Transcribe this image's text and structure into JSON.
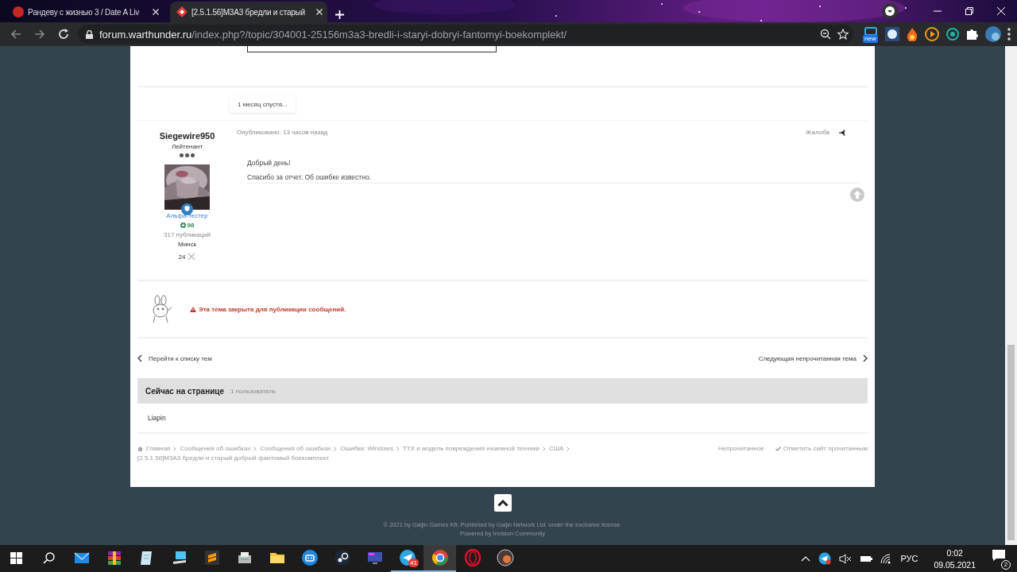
{
  "browser": {
    "tabs": [
      {
        "title": "Рандеву с жизнью 3 / Date A Liv",
        "selected": false
      },
      {
        "title": "[2.5.1.56]M3A3 бредли и старый",
        "selected": true
      }
    ],
    "address": {
      "host": "forum.warthunder.ru",
      "path": "/index.php?/topic/304001-25156m3a3-bredli-i-staryi-dobryi-fantomyi-boekomplekt/"
    },
    "extension_badge": "new"
  },
  "forum": {
    "time_gap": "1 месяц спустя...",
    "post": {
      "author": "Siegewire950",
      "rank": "Лейтенант",
      "group": "Альфа-тестер",
      "reputation": "98",
      "posts": "317 публикаций",
      "location": "Минск",
      "medals": "24",
      "posted": "Опубликовано: 13 часов назад",
      "report": "Жалоба",
      "body": [
        "Добрый день!",
        "Спасибо за отчет. Об ошибке известно."
      ]
    },
    "locked_notice": "Эта тема закрыта для публикации сообщений.",
    "prev_link": "Перейти к списку тем",
    "next_link": "Следующая непрочитанная тема",
    "online": {
      "title": "Сейчас на странице",
      "count": "1 пользователь",
      "users": [
        "Liapin"
      ]
    },
    "breadcrumbs": [
      "Главная",
      "Сообщения об ошибках",
      "Сообщения об ошибках",
      "Ошибки: Windows",
      "ТТХ и модель повреждения наземной техники",
      "США"
    ],
    "topic_title": "[2.5.1.56]M3A3 бредли и старый добрый фантомый боекомплект",
    "footer_links": [
      "Непрочитанное",
      "Отметить сайт прочитанным"
    ],
    "copyright": "© 2021 by Gaijin Games Kft. Published by Gaijin Network Ltd. under the exclusive license.",
    "powered": "Powered by Invision Community"
  },
  "taskbar": {
    "apps": [
      {
        "kind": "mail",
        "running": false,
        "selected": false
      },
      {
        "kind": "archive",
        "running": false,
        "selected": false
      },
      {
        "kind": "notepad",
        "running": false,
        "selected": false
      },
      {
        "kind": "computer",
        "running": false,
        "selected": false
      },
      {
        "kind": "sublime",
        "running": false,
        "selected": false
      },
      {
        "kind": "scanner",
        "running": false,
        "selected": false
      },
      {
        "kind": "folder",
        "running": false,
        "selected": false
      },
      {
        "kind": "robot",
        "running": false,
        "selected": false
      },
      {
        "kind": "steam",
        "running": false,
        "selected": false
      },
      {
        "kind": "monitor",
        "running": false,
        "selected": false
      },
      {
        "kind": "telegram",
        "running": true,
        "selected": false,
        "badge": "41"
      },
      {
        "kind": "chrome",
        "running": true,
        "selected": true
      },
      {
        "kind": "opera",
        "running": false,
        "selected": false
      },
      {
        "kind": "orb",
        "running": false,
        "selected": false
      }
    ],
    "language": "РУС",
    "time": "0:02",
    "date": "09.05.2021",
    "notifications": "2"
  }
}
